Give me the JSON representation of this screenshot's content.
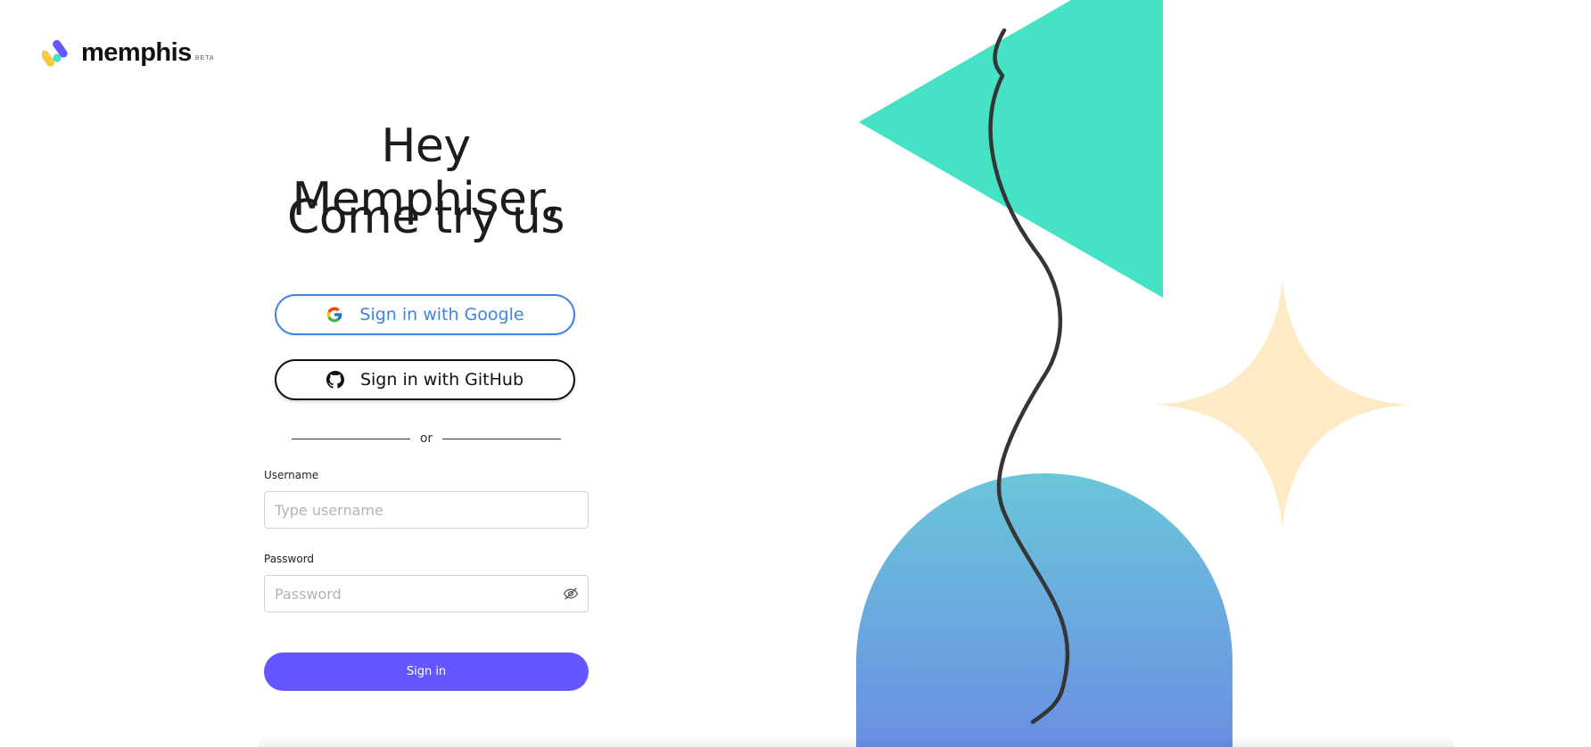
{
  "logo": {
    "name": "memphis",
    "badge": "BETA"
  },
  "hero": {
    "line1": "Hey Memphiser,",
    "line2": "Come try us"
  },
  "oauth": {
    "google_label": "Sign in with Google",
    "github_label": "Sign in with GitHub",
    "divider_text": "or"
  },
  "form": {
    "username_label": "Username",
    "username_placeholder": "Type username",
    "username_value": "",
    "password_label": "Password",
    "password_placeholder": "Password",
    "password_value": "",
    "submit_label": "Sign in"
  },
  "colors": {
    "accent": "#6557ff",
    "google_blue": "#3f84e5",
    "teal": "#45e2c6",
    "cream": "#fdebc6",
    "sky_top": "#6ac6da",
    "sky_bottom": "#6a8fe3"
  },
  "icons": [
    "memphis-logo-icon",
    "google-icon",
    "github-icon",
    "eye-off-icon"
  ]
}
